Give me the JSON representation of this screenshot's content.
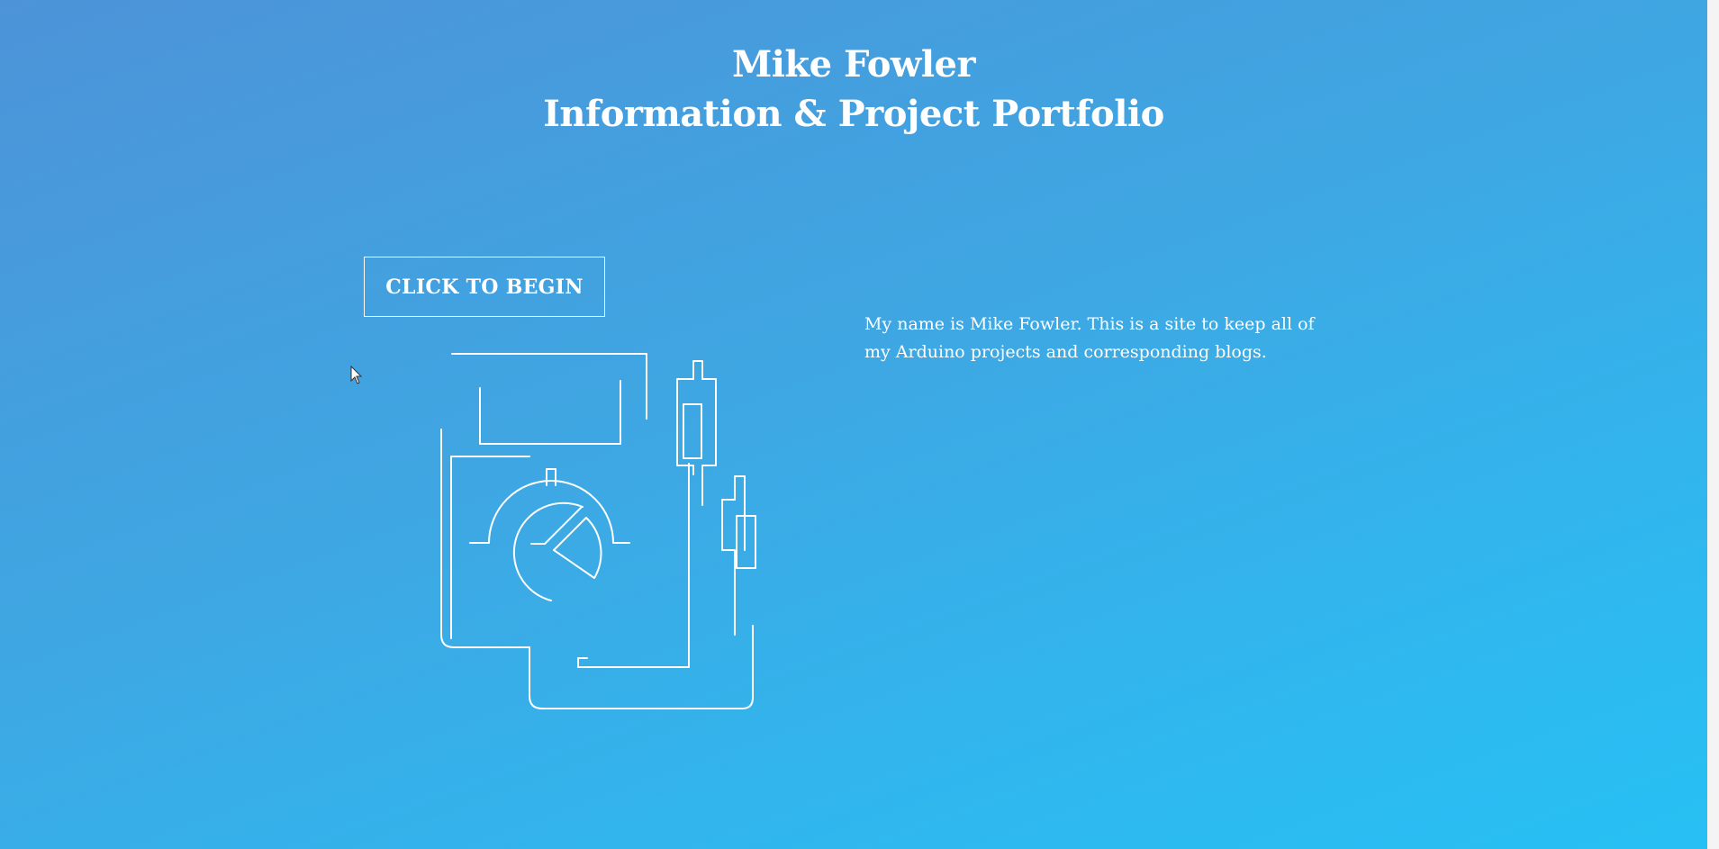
{
  "header": {
    "name": "Mike Fowler",
    "subtitle": "Information & Project Portfolio"
  },
  "cta": {
    "label": "CLICK TO BEGIN"
  },
  "intro": {
    "text": "My name is Mike Fowler. This is a site to keep all of my Arduino projects and corresponding blogs."
  },
  "illustration": {
    "icon": "analytics-dashboard-line-icon"
  },
  "colors": {
    "gradient_start": "#4d93d8",
    "gradient_end": "#27c0f4",
    "foreground": "#ffffff"
  }
}
